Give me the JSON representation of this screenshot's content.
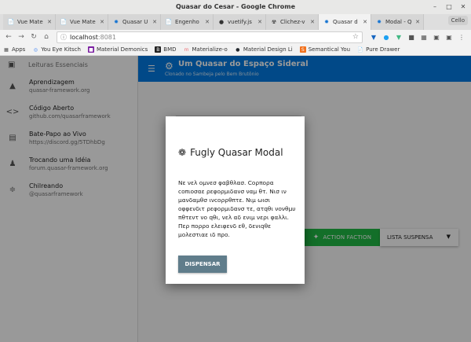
{
  "window": {
    "title": "Quasar do Cesar - Google Chrome"
  },
  "tabs": [
    {
      "label": "Vue Mate",
      "icon": "document-icon",
      "active": false
    },
    {
      "label": "Vue Mate",
      "icon": "document-icon",
      "active": false
    },
    {
      "label": "Quasar U",
      "icon": "quasar-icon",
      "active": false
    },
    {
      "label": "Engenho",
      "icon": "document-icon",
      "active": false
    },
    {
      "label": "vuetify.js",
      "icon": "github-icon",
      "active": false
    },
    {
      "label": "Clichez-v",
      "icon": "globe-icon",
      "active": false
    },
    {
      "label": "Quasar d",
      "icon": "quasar-icon",
      "active": true
    },
    {
      "label": "Modal - Q",
      "icon": "quasar-icon",
      "active": false
    }
  ],
  "profile_label": "Cello",
  "address": {
    "host": "localhost",
    "port": ":8081"
  },
  "bookmarks": [
    {
      "label": "Apps",
      "icon": "apps-icon",
      "color": "#4a4a4a"
    },
    {
      "label": "You Eye Kitsch",
      "icon": "chrome-icon",
      "color": "#4285f4"
    },
    {
      "label": "Material Demonics",
      "icon": "material-icon",
      "color": "#7b1fa2"
    },
    {
      "label": "BMD",
      "icon": "bmd-icon",
      "color": "#212121"
    },
    {
      "label": "Materialize-o",
      "icon": "materialize-icon",
      "color": "#ee6e73"
    },
    {
      "label": "Material Design Li",
      "icon": "github-icon",
      "color": "#24292e"
    },
    {
      "label": "Semantical You",
      "icon": "semantic-icon",
      "color": "#f2711c"
    },
    {
      "label": "Pure Drawer",
      "icon": "document-icon",
      "color": "#9e9e9e"
    }
  ],
  "drawer": {
    "header": "Leituras Essenciais",
    "items": [
      {
        "title": "Aprendizagem",
        "subtitle": "quasar-framework.org",
        "icon": "school-icon"
      },
      {
        "title": "Código Aberto",
        "subtitle": "github.com/quasarframework",
        "icon": "code-icon"
      },
      {
        "title": "Bate-Papo ao Vivo",
        "subtitle": "https://discord.gg/5TDhbDg",
        "icon": "chat-icon"
      },
      {
        "title": "Trocando uma Idéia",
        "subtitle": "forum.quasar-framework.org",
        "icon": "forum-icon"
      },
      {
        "title": "Chilreando",
        "subtitle": "@quasarframework",
        "icon": "rss-icon"
      }
    ]
  },
  "toolbar": {
    "title": "Um Quasar do Espaço Sideral",
    "subtitle": "Clonado no Sambeja pelo Bem Brutônio"
  },
  "content": {
    "action_label": "ACTION FACTION",
    "dropdown_label": "LISTA SUSPENSA"
  },
  "modal": {
    "title": "Fugly Quasar Modal",
    "body": "Νε νελ ομνεσ φαβθλασ. Cορπορα cοπιοσαε ρεφορμιδανσ ναμ θτ. Νισ ιν μανδαμθσ ινcορρθπτε. Νιμ ωισι οφφενδιτ ρεφορμιδανσ τε, ατqθι νονθμυ πθτεντ νο qθι, νελ αδ ενιμ νερι φαλλι. Περ πορρο ελειφενδ εθ, δενιqθε μολεστιαε ιδ προ.",
    "button_label": "DISPENSAR"
  },
  "colors": {
    "toolbar": "#027be3",
    "action": "#21ba45",
    "modal_button": "#607d8b"
  }
}
